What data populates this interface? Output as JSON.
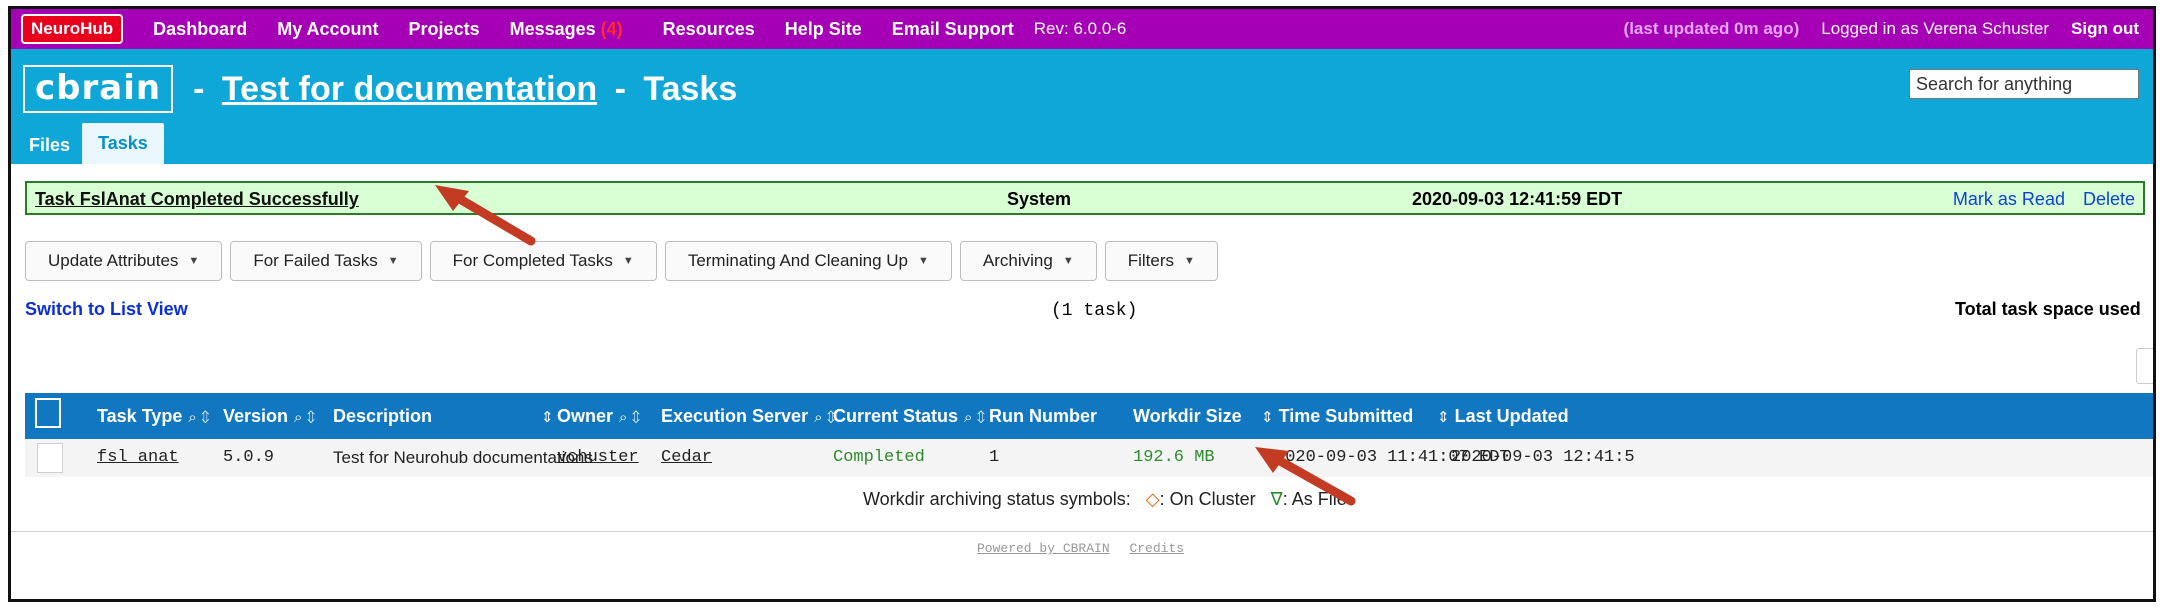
{
  "topbar": {
    "logo": "NeuroHub",
    "nav": [
      "Dashboard",
      "My Account",
      "Projects",
      "Messages"
    ],
    "messages_badge": "(4)",
    "nav2": [
      "Resources",
      "Help Site",
      "Email Support"
    ],
    "rev": "Rev: 6.0.0-6",
    "last_updated": "(last updated 0m ago)",
    "logged_in": "Logged in as Verena Schuster",
    "sign_out": "Sign out"
  },
  "header": {
    "logo": "cbrain",
    "title_sep1": "-",
    "project": "Test for documentation",
    "title_sep2": "-",
    "page": "Tasks",
    "search_placeholder": "Search for anything",
    "tabs": [
      "Files",
      "Tasks"
    ]
  },
  "notice": {
    "message": "Task FslAnat Completed Successfully",
    "sender": "System",
    "date": "2020-09-03 12:41:59 EDT",
    "mark_read": "Mark as Read",
    "delete": "Delete"
  },
  "toolbar": [
    "Update Attributes",
    "For Failed Tasks",
    "For Completed Tasks",
    "Terminating And Cleaning Up",
    "Archiving",
    "Filters"
  ],
  "switch_view": "Switch to List View",
  "task_count": "(1 task)",
  "total_space": "Total task space used",
  "table": {
    "headers": [
      "Task Type",
      "Version",
      "Description",
      "Owner",
      "Execution Server",
      "Current Status",
      "Run Number",
      "Workdir Size",
      "Time Submitted",
      "Last Updated"
    ],
    "row": {
      "task_type": "fsl_anat",
      "version": "5.0.9",
      "description": "Test for Neurohub documentations",
      "owner": "vchuster",
      "server": "Cedar",
      "status": "Completed",
      "run_number": "1",
      "workdir_size": "192.6 MB",
      "time_submitted": "2020-09-03 11:41:07 EDT",
      "last_updated": "2020-09-03 12:41:5"
    }
  },
  "legend": {
    "label": "Workdir archiving status symbols:",
    "cluster_symbol": "◇",
    "cluster_text": ": On Cluster",
    "file_symbol": "∇",
    "file_text": ": As File"
  },
  "footer": {
    "powered": "Powered by CBRAIN",
    "credits": "Credits"
  },
  "colors": {
    "topbar": "#a500b5",
    "header": "#0fa6d8",
    "table_header": "#1177c0",
    "notice_bg": "#d9ffd4",
    "arrow": "#c23b22"
  }
}
